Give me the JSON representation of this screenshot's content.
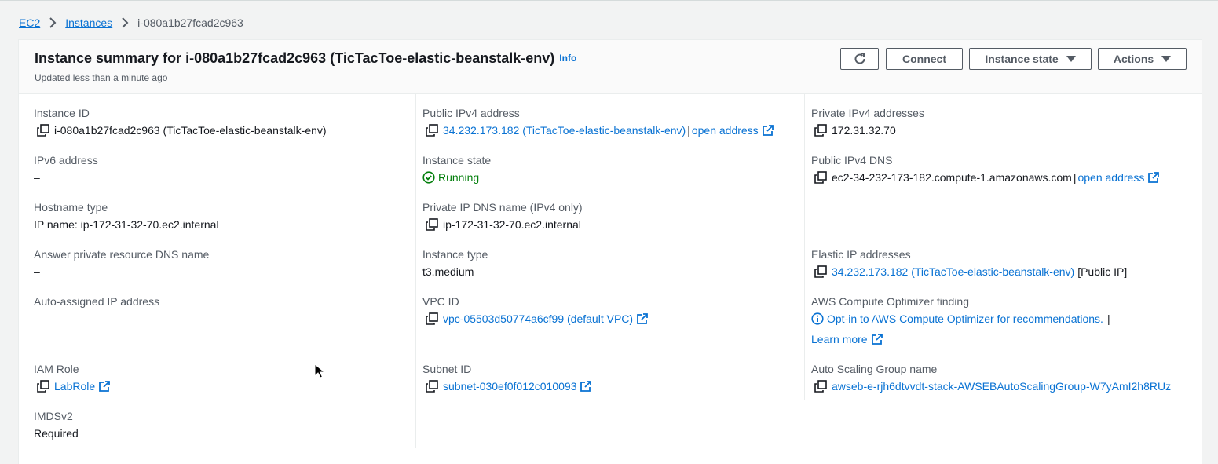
{
  "breadcrumb": {
    "items": [
      "EC2",
      "Instances"
    ],
    "current": "i-080a1b27fcad2c963"
  },
  "header": {
    "title": "Instance summary for i-080a1b27fcad2c963 (TicTacToe-elastic-beanstalk-env)",
    "info": "Info",
    "updated": "Updated less than a minute ago",
    "buttons": {
      "connect": "Connect",
      "instance_state": "Instance state",
      "actions": "Actions"
    }
  },
  "fields": {
    "instance_id": {
      "label": "Instance ID",
      "value": "i-080a1b27fcad2c963 (TicTacToe-elastic-beanstalk-env)"
    },
    "ipv6": {
      "label": "IPv6 address",
      "value": "–"
    },
    "hostname_type": {
      "label": "Hostname type",
      "value": "IP name: ip-172-31-32-70.ec2.internal"
    },
    "answer_dns": {
      "label": "Answer private resource DNS name",
      "value": "–"
    },
    "auto_ip": {
      "label": "Auto-assigned IP address",
      "value": "–"
    },
    "iam_role": {
      "label": "IAM Role",
      "value": "LabRole"
    },
    "imdsv2": {
      "label": "IMDSv2",
      "value": "Required"
    },
    "public_ipv4": {
      "label": "Public IPv4 address",
      "value": "34.232.173.182 (TicTacToe-elastic-beanstalk-env)",
      "sep": "|",
      "link": "open address"
    },
    "instance_state": {
      "label": "Instance state",
      "value": "Running"
    },
    "private_ip_dns": {
      "label": "Private IP DNS name (IPv4 only)",
      "value": "ip-172-31-32-70.ec2.internal"
    },
    "instance_type": {
      "label": "Instance type",
      "value": "t3.medium"
    },
    "vpc_id": {
      "label": "VPC ID",
      "value": "vpc-05503d50774a6cf99 (default VPC)"
    },
    "subnet_id": {
      "label": "Subnet ID",
      "value": "subnet-030ef0f012c010093"
    },
    "private_ipv4": {
      "label": "Private IPv4 addresses",
      "value": "172.31.32.70"
    },
    "public_dns": {
      "label": "Public IPv4 DNS",
      "value": "ec2-34-232-173-182.compute-1.amazonaws.com",
      "sep": "|",
      "link": "open address"
    },
    "elastic_ip": {
      "label": "Elastic IP addresses",
      "value": "34.232.173.182 (TicTacToe-elastic-beanstalk-env)",
      "suffix": "[Public IP]"
    },
    "optimizer": {
      "label": "AWS Compute Optimizer finding",
      "value": "Opt-in to AWS Compute Optimizer for recommendations.",
      "sep": "|",
      "learn": "Learn more"
    },
    "asg": {
      "label": "Auto Scaling Group name",
      "value": "awseb-e-rjh6dtvvdt-stack-AWSEBAutoScalingGroup-W7yAmI2h8RUz"
    }
  },
  "colors": {
    "link": "#0972d3",
    "running": "#037f0c",
    "label": "#545b64"
  }
}
